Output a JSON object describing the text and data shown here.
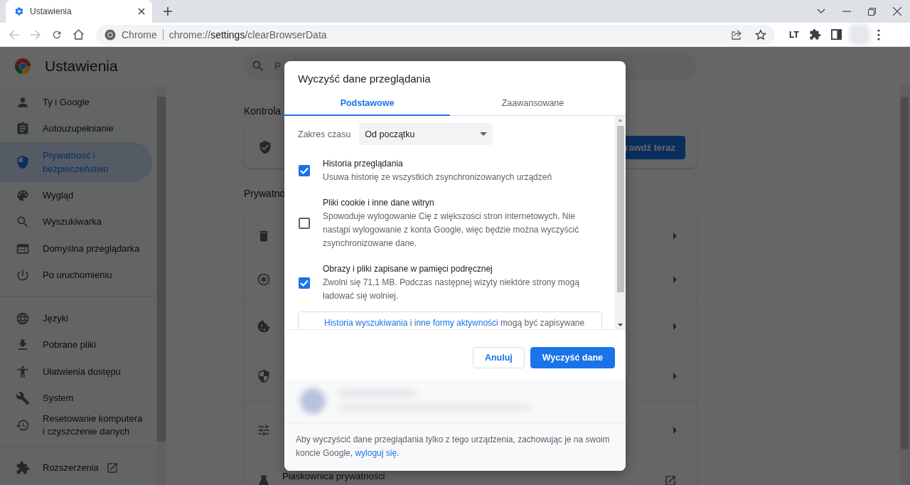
{
  "browser": {
    "tab": {
      "title": "Ustawienia",
      "selected": true
    },
    "omnibox": {
      "site_label": "Chrome",
      "url": "chrome://**settings**/clearBrowserData"
    },
    "navigation": {
      "back_disabled": true,
      "forward_disabled": true
    },
    "extension_label": "LT"
  },
  "settings": {
    "title": "Ustawienia",
    "search": {
      "placeholder": "P"
    },
    "sidebar": {
      "groups": [
        {
          "items": [
            {
              "label": "Ty i Google",
              "kind": "person",
              "selected": false
            },
            {
              "label": "Autouzupełnianie",
              "kind": "clipboard",
              "selected": false
            },
            {
              "label": "Prywatność i bezpieczeństwo",
              "kind": "shield",
              "selected": true
            },
            {
              "label": "Wygląd",
              "kind": "palette",
              "selected": false
            },
            {
              "label": "Wyszukiwarka",
              "kind": "search",
              "selected": false
            },
            {
              "label": "Domyślna przeglądarka",
              "kind": "browser",
              "selected": false
            },
            {
              "label": "Po uruchomieniu",
              "kind": "power",
              "selected": false
            }
          ]
        },
        {
          "items": [
            {
              "label": "Języki",
              "kind": "globe",
              "selected": false
            },
            {
              "label": "Pobrane pliki",
              "kind": "download",
              "selected": false
            },
            {
              "label": "Ułatwienia dostępu",
              "kind": "accessibility",
              "selected": false
            },
            {
              "label": "System",
              "kind": "wrench",
              "selected": false
            },
            {
              "label": "Resetowanie komputera i czyszczenie danych",
              "kind": "history",
              "selected": false
            }
          ]
        },
        {
          "items": [
            {
              "label": "Rozszerzenia",
              "kind": "puzzle",
              "selected": false,
              "external": true
            }
          ]
        }
      ]
    },
    "safety_heading": "Kontrola",
    "safety_button": "rawdź teraz",
    "privacy_heading": "Prywatno",
    "privacy_rows": [
      {
        "kind": "trash"
      },
      {
        "kind": "asterisk-circle"
      },
      {
        "kind": "cookie"
      },
      {
        "kind": "shield-half"
      },
      {
        "kind": "sliders"
      },
      {
        "kind": "flask",
        "label": "Piaskownica prywatności",
        "external": true
      }
    ]
  },
  "dialog": {
    "title": "Wyczyść dane przeglądania",
    "tabs": [
      {
        "label": "Podstawowe",
        "selected": true
      },
      {
        "label": "Zaawansowane",
        "selected": false
      }
    ],
    "time_range": {
      "label": "Zakres czasu",
      "value": "Od początku"
    },
    "options": [
      {
        "title": "Historia przeglądania",
        "description": "Usuwa historię ze wszystkich zsynchronizowanych urządzeń",
        "checked": true
      },
      {
        "title": "Pliki cookie i inne dane witryn",
        "description": "Spowoduje wylogowanie Cię z większości stron internetowych. Nie nastąpi wylogowanie z konta Google, więc będzie można wyczyścić zsynchronizowane dane.",
        "checked": false
      },
      {
        "title": "Obrazy i pliki zapisane w pamięci podręcznej",
        "description": "Zwolni się 71,1 MB. Podczas następnej wizyty niektóre strony mogą ładować się wolniej.",
        "checked": true
      }
    ],
    "notice": [
      {
        "text": "Historia wyszukiwania",
        "link": true
      },
      {
        "text": " i ",
        "link": false
      },
      {
        "text": "inne formy aktywności",
        "link": true
      },
      {
        "text": " mogą być zapisywane",
        "link": false
      }
    ],
    "cancel_button": "Anuluj",
    "confirm_button": "Wyczyść dane",
    "footer": {
      "text": "Aby wyczyścić dane przeglądania tylko z tego urządzenia, zachowując je na swoim koncie Google, ",
      "link": "wyloguj się",
      "after": "."
    }
  }
}
